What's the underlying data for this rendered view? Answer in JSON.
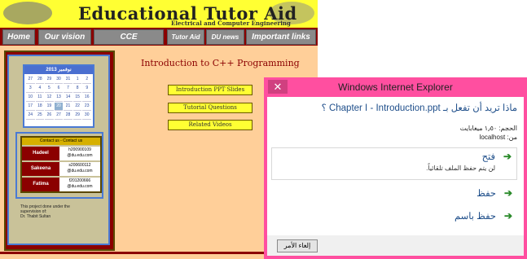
{
  "site": {
    "title": "Educational Tutor Aid",
    "subtitle": "Electrical and Computer Engineering"
  },
  "nav": {
    "home": "Home",
    "vision": "Our vision",
    "cce": "CCE",
    "tutor": "Tutor Aid",
    "du": "DU news",
    "links": "Important links"
  },
  "calendar": {
    "header": "2013 نوفمبر",
    "days": [
      "27",
      "28",
      "29",
      "30",
      "31",
      "1",
      "2",
      "3",
      "4",
      "5",
      "6",
      "7",
      "8",
      "9",
      "10",
      "11",
      "12",
      "13",
      "14",
      "15",
      "16",
      "17",
      "18",
      "19",
      "20",
      "21",
      "22",
      "23",
      "24",
      "25",
      "26",
      "27",
      "28",
      "29",
      "30"
    ],
    "today": "20"
  },
  "contact": {
    "header": "Contact us - Contact us",
    "rows": [
      {
        "name": "Hadeel",
        "email_a": "h200900109",
        "email_b": "@du.edu.com"
      },
      {
        "name": "Sakeena",
        "email_a": "s200600112",
        "email_b": "@du.edu.com"
      },
      {
        "name": "Fatima",
        "email_a": "f201200666",
        "email_b": "@du.edu.com"
      }
    ]
  },
  "note": {
    "line1": "This project done under the",
    "line2": "supervision of:",
    "line3": "Dr. Thabit Sultan"
  },
  "main": {
    "course_title": "Introduction to C++ Programming",
    "btn_ppt": "Introduction PPT Slides",
    "btn_tq": "Tutorial Questions",
    "btn_rv": "Related Videos"
  },
  "dialog": {
    "window_title": "Windows Internet Explorer",
    "close_glyph": "✕",
    "question": "ماذا تريد أن تفعل بـ Chapter I - Introduction.ppt ؟",
    "size_line": "الحجم: ١٫٥٠ ميغابايت",
    "from_line": "من: localhost",
    "open_label": "فتح",
    "open_desc": "لن يتم حفظ الملف تلقائياً.",
    "save_label": "حفظ",
    "saveas_label": "حفظ باسم",
    "cancel_label": "إلغاء الأمر",
    "arrow_glyph": "➔"
  },
  "colors": {
    "page_bg": "#ffcf99",
    "banner": "#ffff33",
    "nav_bar": "#8b0000",
    "dialog_frame": "#ff4fa0",
    "link_blue": "#1e4e8a",
    "arrow_green": "#2a8a2a"
  },
  "icons": {
    "close": "close-icon",
    "arrow": "green-arrow-icon"
  }
}
